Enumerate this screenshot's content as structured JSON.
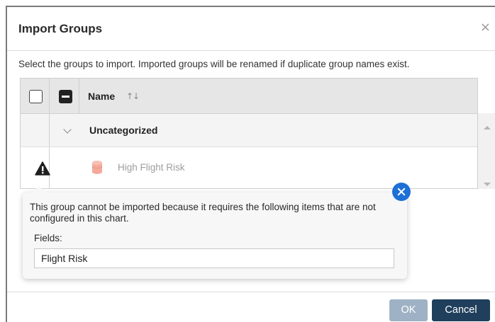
{
  "dialog": {
    "title": "Import Groups",
    "close_glyph": "×",
    "instructions": "Select the groups to import. Imported groups will be renamed if duplicate group names exist."
  },
  "table": {
    "header": {
      "name_label": "Name",
      "sort_glyph": "↑↓"
    },
    "groups": [
      {
        "name": "Uncategorized",
        "expanded": true,
        "items": [
          {
            "name": "High Flight Risk",
            "status": "warning",
            "icon": "database-icon",
            "icon_color": "#f2a596"
          }
        ]
      }
    ]
  },
  "popover": {
    "message": "This group cannot be imported because it requires the following items that are not configured in this chart.",
    "fields_label": "Fields:",
    "fields_value": "Flight Risk"
  },
  "footer": {
    "ok_label": "OK",
    "cancel_label": "Cancel"
  },
  "colors": {
    "accent_blue": "#1e6fd6",
    "ok_disabled": "#9fb2c5",
    "cancel_bg": "#1f3f5c"
  }
}
